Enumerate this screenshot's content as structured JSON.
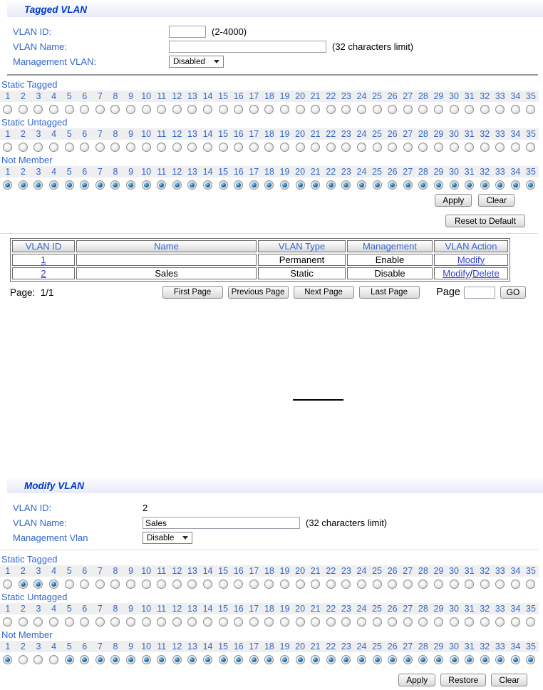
{
  "ports": {
    "count": 35
  },
  "panels": {
    "tagged": {
      "title": "Tagged VLAN",
      "fields": {
        "vlan_id_label": "VLAN ID:",
        "vlan_id_value": "",
        "vlan_id_hint": "(2-4000)",
        "vlan_name_label": "VLAN Name:",
        "vlan_name_value": "",
        "vlan_name_hint": "(32 characters limit)",
        "mgmt_label": "Management VLAN:",
        "mgmt_value": "Disabled"
      },
      "port_sections": [
        {
          "key": "static-tagged",
          "label": "Static Tagged",
          "selected": []
        },
        {
          "key": "static-untagged",
          "label": "Static Untagged",
          "selected": []
        },
        {
          "key": "not-member",
          "label": "Not Member",
          "selected": [
            1,
            2,
            3,
            4,
            5,
            6,
            7,
            8,
            9,
            10,
            11,
            12,
            13,
            14,
            15,
            16,
            17,
            18,
            19,
            20,
            21,
            22,
            23,
            24,
            25,
            26,
            27,
            28,
            29,
            30,
            31,
            32,
            33,
            34,
            35
          ]
        }
      ],
      "buttons": {
        "apply": "Apply",
        "clear": "Clear",
        "reset": "Reset to Default"
      }
    },
    "table": {
      "headers": [
        "VLAN ID",
        "Name",
        "VLAN Type",
        "Management",
        "VLAN Action"
      ],
      "rows": [
        {
          "id": "1",
          "name": "",
          "type": "Permanent",
          "management": "Enable",
          "actions": [
            "Modify"
          ]
        },
        {
          "id": "2",
          "name": "Sales",
          "type": "Static",
          "management": "Disable",
          "actions": [
            "Modify",
            "Delete"
          ]
        }
      ],
      "page_status_label": "Page:",
      "page_status_value": "1/1",
      "pager_buttons": [
        "First Page",
        "Previous Page",
        "Next Page",
        "Last Page"
      ],
      "page_label": "Page",
      "page_input_value": "",
      "go_label": "GO"
    },
    "modify": {
      "title": "Modify VLAN",
      "fields": {
        "vlan_id_label": "VLAN ID:",
        "vlan_id_value": "2",
        "vlan_name_label": "VLAN Name:",
        "vlan_name_value": "Sales",
        "vlan_name_hint": "(32 characters limit)",
        "mgmt_label": "Management Vlan",
        "mgmt_value": "Disable"
      },
      "port_sections": [
        {
          "key": "static-tagged",
          "label": "Static Tagged",
          "selected": [
            2,
            3,
            4
          ]
        },
        {
          "key": "static-untagged",
          "label": "Static Untagged",
          "selected": []
        },
        {
          "key": "not-member",
          "label": "Not Member",
          "selected": [
            1,
            5,
            6,
            7,
            8,
            9,
            10,
            11,
            12,
            13,
            14,
            15,
            16,
            17,
            18,
            19,
            20,
            21,
            22,
            23,
            24,
            25,
            26,
            27,
            28,
            29,
            30,
            31,
            32,
            33,
            34,
            35
          ]
        }
      ],
      "buttons": {
        "apply": "Apply",
        "restore": "Restore",
        "clear": "Clear"
      }
    }
  }
}
